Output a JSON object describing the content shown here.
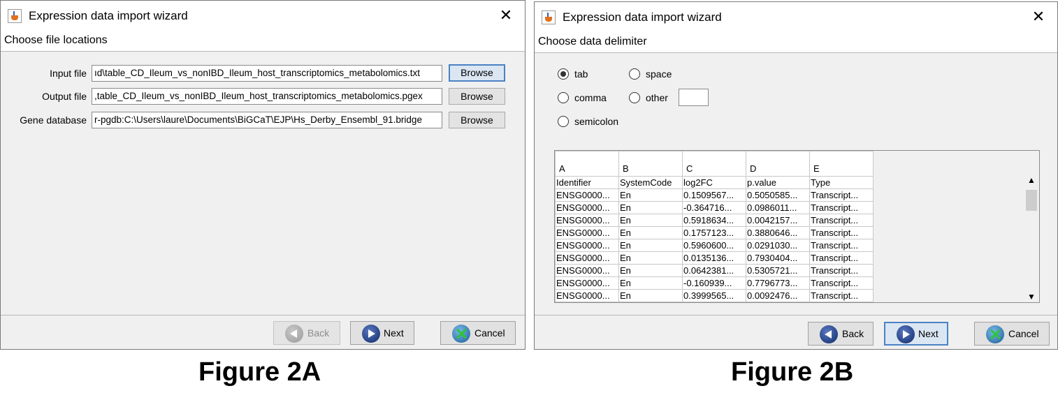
{
  "figure_a": {
    "window_title": "Expression data import wizard",
    "step_title": "Choose file locations",
    "rows": [
      {
        "label": "Input file",
        "value": "ıd\\table_CD_Ileum_vs_nonIBD_Ileum_host_transcriptomics_metabolomics.txt",
        "button": "Browse"
      },
      {
        "label": "Output file",
        "value": ",table_CD_Ileum_vs_nonIBD_Ileum_host_transcriptomics_metabolomics.pgex",
        "button": "Browse"
      },
      {
        "label": "Gene database",
        "value": "r-pgdb:C:\\Users\\laure\\Documents\\BiGCaT\\EJP\\Hs_Derby_Ensembl_91.bridge",
        "button": "Browse"
      }
    ],
    "back_label": "Back",
    "next_label": "Next",
    "cancel_label": "Cancel",
    "caption": "Figure 2A"
  },
  "figure_b": {
    "window_title": "Expression data import wizard",
    "step_title": "Choose data delimiter",
    "delimiters": [
      {
        "label": "tab",
        "selected": true
      },
      {
        "label": "space",
        "selected": false
      },
      {
        "label": "comma",
        "selected": false
      },
      {
        "label": "other",
        "selected": false
      },
      {
        "label": "semicolon",
        "selected": false
      }
    ],
    "other_value": "",
    "column_letters": [
      "A",
      "B",
      "C",
      "D",
      "E"
    ],
    "rows": [
      [
        "Identifier",
        "SystemCode",
        "log2FC",
        "p.value",
        "Type"
      ],
      [
        "ENSG0000...",
        "En",
        "0.1509567...",
        "0.5050585...",
        "Transcript..."
      ],
      [
        "ENSG0000...",
        "En",
        "-0.364716...",
        "0.0986011...",
        "Transcript..."
      ],
      [
        "ENSG0000...",
        "En",
        "0.5918634...",
        "0.0042157...",
        "Transcript..."
      ],
      [
        "ENSG0000...",
        "En",
        "0.1757123...",
        "0.3880646...",
        "Transcript..."
      ],
      [
        "ENSG0000...",
        "En",
        "0.5960600...",
        "0.0291030...",
        "Transcript..."
      ],
      [
        "ENSG0000...",
        "En",
        "0.0135136...",
        "0.7930404...",
        "Transcript..."
      ],
      [
        "ENSG0000...",
        "En",
        "0.0642381...",
        "0.5305721...",
        "Transcript..."
      ],
      [
        "ENSG0000...",
        "En",
        "-0.160939...",
        "0.7796773...",
        "Transcript..."
      ],
      [
        "ENSG0000...",
        "En",
        "0.3999565...",
        "0.0092476...",
        "Transcript..."
      ]
    ],
    "back_label": "Back",
    "next_label": "Next",
    "cancel_label": "Cancel",
    "caption": "Figure 2B"
  }
}
